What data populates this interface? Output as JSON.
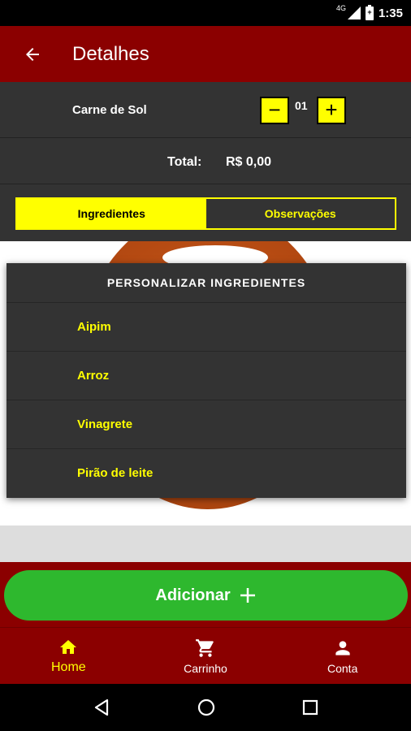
{
  "status_bar": {
    "network": "4G",
    "battery": "+",
    "time": "1:35"
  },
  "app_bar": {
    "title": "Detalhes"
  },
  "product": {
    "name": "Carne de Sol",
    "quantity": "01",
    "minus_label": "−",
    "plus_label": "+",
    "total_label": "Total:",
    "total_value": "R$ 0,00"
  },
  "tabs": [
    {
      "label": "Ingredientes",
      "active": true
    },
    {
      "label": "Observações",
      "active": false
    }
  ],
  "dialog": {
    "title": "PERSONALIZAR INGREDIENTES",
    "ingredients": [
      "Aipim",
      "Arroz",
      "Vinagrete",
      "Pirão de leite"
    ]
  },
  "add_button": {
    "label": "Adicionar",
    "icon": "plus-icon"
  },
  "bottom_nav": [
    {
      "label": "Home",
      "icon": "home-icon",
      "active": true
    },
    {
      "label": "Carrinho",
      "icon": "cart-icon",
      "active": false
    },
    {
      "label": "Conta",
      "icon": "person-icon",
      "active": false
    }
  ],
  "colors": {
    "primary": "#8b0000",
    "accent": "#ffff00",
    "panel": "#333333",
    "add_button": "#2eb82e"
  }
}
